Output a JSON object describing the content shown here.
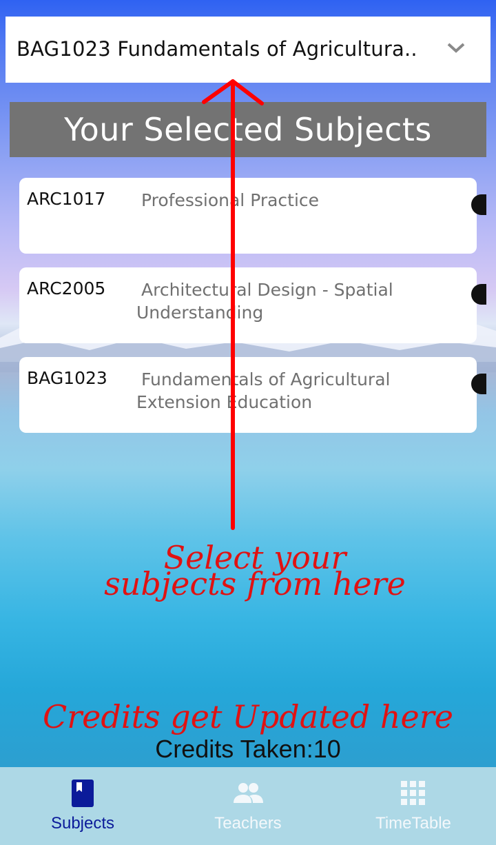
{
  "dropdown": {
    "selected": "BAG1023  Fundamentals of Agricultura..",
    "icon": "chevron-down-icon"
  },
  "header": {
    "title": "Your Selected Subjects"
  },
  "subjects": [
    {
      "code": "ARC1017",
      "name_line1": "Professional Practice",
      "name_line2": ""
    },
    {
      "code": "ARC2005",
      "name_line1": "Architectural Design - Spatial",
      "name_line2": "Understanding"
    },
    {
      "code": "BAG1023",
      "name_line1": "Fundamentals of Agricultural",
      "name_line2": "Extension Education"
    }
  ],
  "annotations": {
    "select_line1": "Select your",
    "select_line2": "subjects from here",
    "credits_note": "Credits get Updated here"
  },
  "credits": {
    "text": "Credits Taken:10"
  },
  "nav": {
    "tabs": [
      {
        "label": "Subjects",
        "icon": "book-icon",
        "active": true
      },
      {
        "label": "Teachers",
        "icon": "people-icon",
        "active": false
      },
      {
        "label": "TimeTable",
        "icon": "grid-icon",
        "active": false
      }
    ]
  },
  "colors": {
    "header_bg": "#737373",
    "annotation": "#e01212",
    "nav_bg": "#add8e6",
    "nav_active": "#0b1b9a"
  }
}
